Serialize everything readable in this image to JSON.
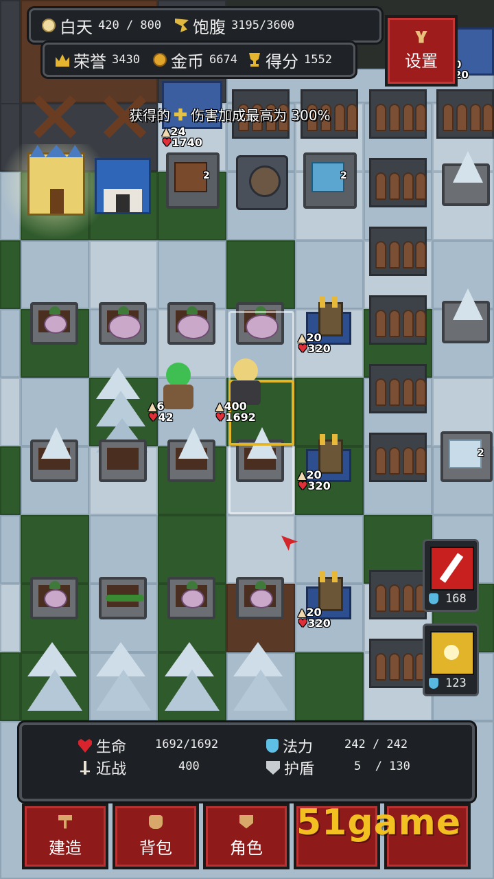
{
  "top_hud": {
    "row1": {
      "daytime_label": "白天",
      "daytime_value": "420 / 800",
      "satiety_label": "饱腹",
      "satiety_value": "3195/3600"
    },
    "row2": {
      "honor_label": "荣誉",
      "honor_value": "3430",
      "gold_label": "金币",
      "gold_value": "6674",
      "score_label": "得分",
      "score_value": "1552"
    },
    "settings_label": "设置"
  },
  "toast": {
    "prefix": "获得的",
    "suffix": "伤害加成最高为 300%"
  },
  "board": {
    "player_top": {
      "attack": "24",
      "hp": "1740"
    },
    "green_hero": {
      "attack": "6",
      "hp": "42"
    },
    "blonde_hero": {
      "attack": "400",
      "hp": "1692"
    },
    "towers": [
      {
        "attack": "20",
        "hp": "320"
      },
      {
        "attack": "20",
        "hp": "320"
      },
      {
        "attack": "20",
        "hp": "320"
      }
    ],
    "corner_tower": {
      "attack": "0",
      "hp": "20"
    },
    "crate_badges": [
      "2",
      "2",
      "2"
    ]
  },
  "skills": [
    {
      "name": "red-slash",
      "cost": "168",
      "color": "#c8201e"
    },
    {
      "name": "golden-burst",
      "cost": "123",
      "color": "#e2b429"
    }
  ],
  "stats": {
    "hp_label": "生命",
    "hp_value": "1692/1692",
    "mana_label": "法力",
    "mana_value": "242 / 242",
    "melee_label": "近战",
    "melee_value": "400",
    "shield_label": "护盾",
    "shield_value": "5  / 130"
  },
  "bottom_buttons": {
    "build": "建造",
    "bag": "背包",
    "role": "角色"
  },
  "watermark": "51game"
}
